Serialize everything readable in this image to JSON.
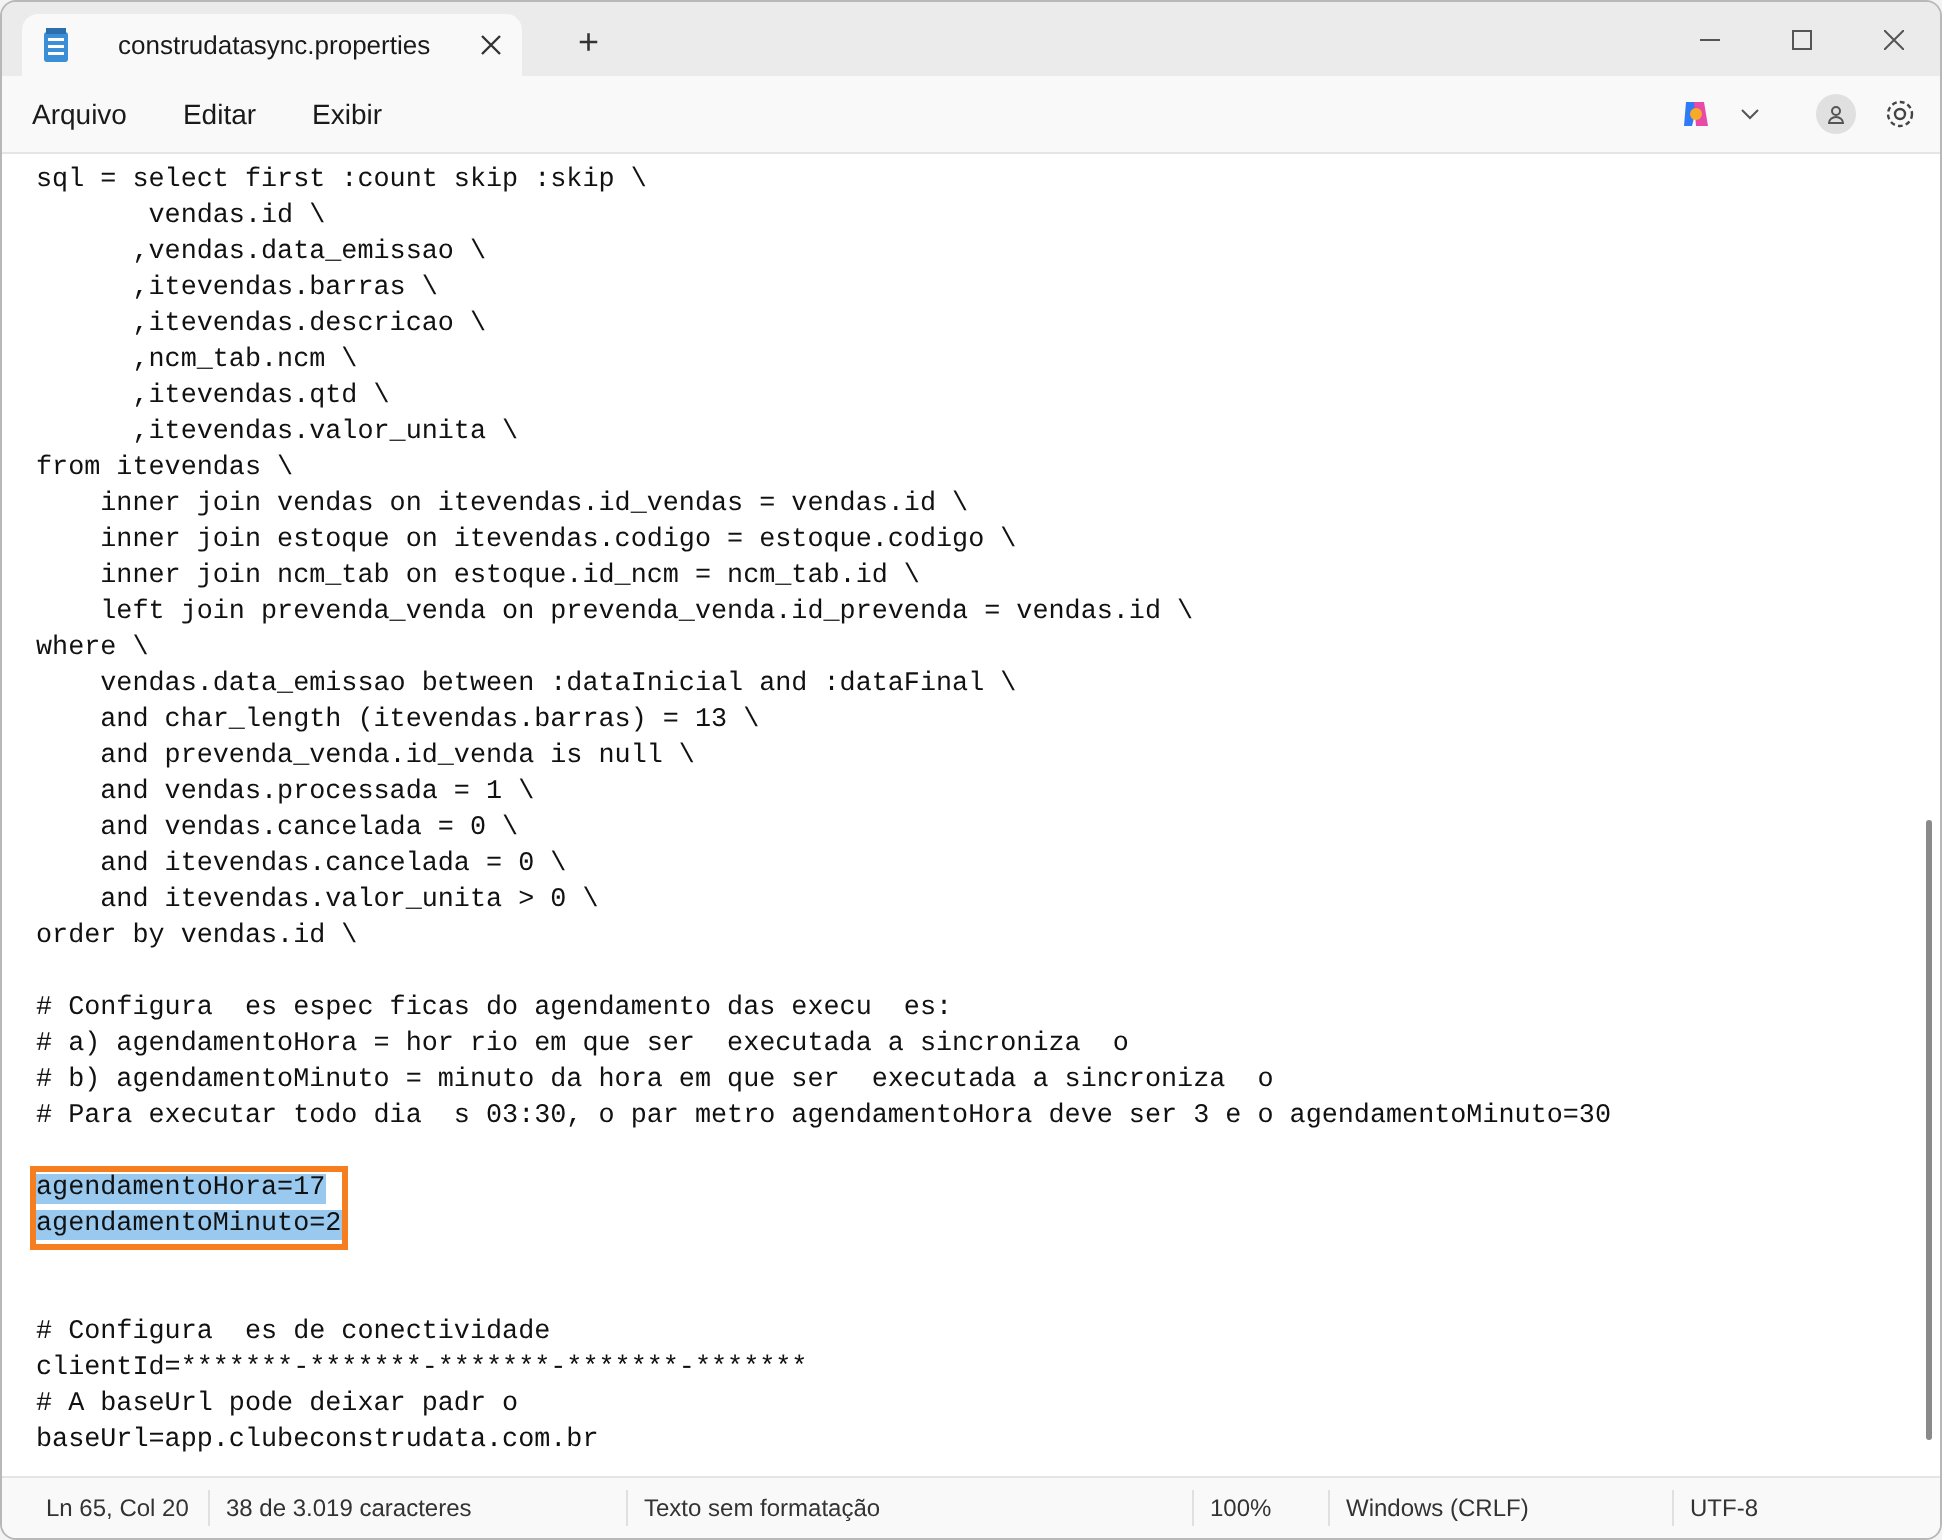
{
  "window": {
    "tab_title": "construdatasync.properties",
    "new_tab_label": "+"
  },
  "menu": [
    {
      "label": "Arquivo"
    },
    {
      "label": "Editar"
    },
    {
      "label": "Exibir"
    }
  ],
  "editor": {
    "lines": [
      {
        "kind": "code",
        "text": "sql = select first :count skip :skip \\",
        "selected": false
      },
      {
        "kind": "code",
        "text": "       vendas.id \\",
        "selected": false
      },
      {
        "kind": "code",
        "text": "      ,vendas.data_emissao \\",
        "selected": false
      },
      {
        "kind": "code",
        "text": "      ,itevendas.barras \\",
        "selected": false
      },
      {
        "kind": "code",
        "text": "      ,itevendas.descricao \\",
        "selected": false
      },
      {
        "kind": "code",
        "text": "      ,ncm_tab.ncm \\",
        "selected": false
      },
      {
        "kind": "code",
        "text": "      ,itevendas.qtd \\",
        "selected": false
      },
      {
        "kind": "code",
        "text": "      ,itevendas.valor_unita \\",
        "selected": false
      },
      {
        "kind": "code",
        "text": "from itevendas \\",
        "selected": false
      },
      {
        "kind": "code",
        "text": "    inner join vendas on itevendas.id_vendas = vendas.id \\",
        "selected": false
      },
      {
        "kind": "code",
        "text": "    inner join estoque on itevendas.codigo = estoque.codigo \\",
        "selected": false
      },
      {
        "kind": "code",
        "text": "    inner join ncm_tab on estoque.id_ncm = ncm_tab.id \\",
        "selected": false
      },
      {
        "kind": "code",
        "text": "    left join prevenda_venda on prevenda_venda.id_prevenda = vendas.id \\",
        "selected": false
      },
      {
        "kind": "code",
        "text": "where \\",
        "selected": false
      },
      {
        "kind": "code",
        "text": "    vendas.data_emissao between :dataInicial and :dataFinal \\",
        "selected": false
      },
      {
        "kind": "code",
        "text": "    and char_length (itevendas.barras) = 13 \\",
        "selected": false
      },
      {
        "kind": "code",
        "text": "    and prevenda_venda.id_venda is null \\",
        "selected": false
      },
      {
        "kind": "code",
        "text": "    and vendas.processada = 1 \\",
        "selected": false
      },
      {
        "kind": "code",
        "text": "    and vendas.cancelada = 0 \\",
        "selected": false
      },
      {
        "kind": "code",
        "text": "    and itevendas.cancelada = 0 \\",
        "selected": false
      },
      {
        "kind": "code",
        "text": "    and itevendas.valor_unita > 0 \\",
        "selected": false
      },
      {
        "kind": "code",
        "text": "order by vendas.id \\",
        "selected": false
      },
      {
        "kind": "blank"
      },
      {
        "kind": "code",
        "text": "# Configura  es espec ficas do agendamento das execu  es:",
        "selected": false
      },
      {
        "kind": "code",
        "text": "# a) agendamentoHora = hor rio em que ser  executada a sincroniza  o",
        "selected": false
      },
      {
        "kind": "code",
        "text": "# b) agendamentoMinuto = minuto da hora em que ser  executada a sincroniza  o",
        "selected": false
      },
      {
        "kind": "code",
        "text": "# Para executar todo dia  s 03:30, o par metro agendamentoHora deve ser 3 e o agendamentoMinuto=30",
        "selected": false
      },
      {
        "kind": "blank"
      },
      {
        "kind": "code",
        "text": "agendamentoHora=17",
        "selected": true
      },
      {
        "kind": "code",
        "text": "agendamentoMinuto=2",
        "selected": true
      },
      {
        "kind": "blank"
      },
      {
        "kind": "blank"
      },
      {
        "kind": "code",
        "text": "# Configura  es de conectividade",
        "selected": false
      },
      {
        "kind": "code",
        "text": "clientId=*******-*******-*******-*******-*******",
        "selected": false
      },
      {
        "kind": "code",
        "text": "# A baseUrl pode deixar padr o",
        "selected": false
      },
      {
        "kind": "code",
        "text": "baseUrl=app.clubeconstrudata.com.br",
        "selected": false
      }
    ]
  },
  "status_bar": {
    "position": "Ln 65, Col 20",
    "selection": "38 de 3.019 caracteres",
    "format": "Texto sem formatação",
    "zoom": "100%",
    "line_ending": "Windows (CRLF)",
    "encoding": "UTF-8"
  }
}
